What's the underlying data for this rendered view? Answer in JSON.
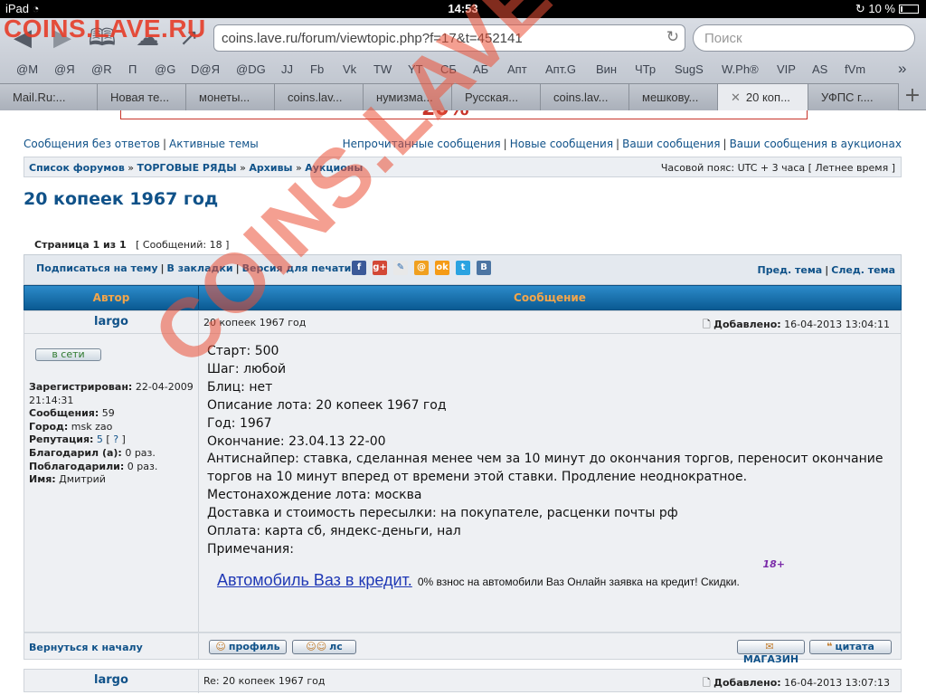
{
  "status": {
    "device": "iPad",
    "time": "14:53",
    "battery": "10 %"
  },
  "browser": {
    "site_logo": "COINS.LAVE.RU",
    "url": "coins.lave.ru/forum/viewtopic.php?f=17&t=452141",
    "search_placeholder": "Поиск",
    "bookmarks": [
      "@M",
      "@Я",
      "@R",
      "П",
      "@G",
      "D@Я",
      "@DG",
      "JJ",
      "Fb",
      "Vk",
      "TW",
      "YT",
      "СБ",
      "АБ",
      "Апт",
      "Апт.G",
      "Вин",
      "ЧТр",
      "SugS",
      "W.Ph®",
      "VIP",
      "AS",
      "fVm",
      "»"
    ],
    "tabs": [
      "Mail.Ru:...",
      "Новая те...",
      "монеты...",
      "coins.lav...",
      "нумизма...",
      "Русская...",
      "coins.lav...",
      "мешкову...",
      "20 коп...",
      "УФПС г...."
    ]
  },
  "links": {
    "unanswered": "Сообщения без ответов",
    "active": "Активные темы",
    "unread": "Непрочитанные сообщения",
    "new": "Новые сообщения",
    "yours": "Ваши сообщения",
    "yours_auctions": "Ваши сообщения в аукционах"
  },
  "breadcrumb": {
    "items": [
      "Список форумов",
      "ТОРГОВЫЕ РЯДЫ",
      "Архивы",
      "Аукционы"
    ],
    "timezone": "Часовой пояс: UTC + 3 часа [ Летнее время ]"
  },
  "topic": {
    "title": "20 копеек 1967 год",
    "page_label": "Страница",
    "page_current": "1",
    "page_of": "из",
    "page_total": "1",
    "messages": "[ Сообщений: 18 ]"
  },
  "actions": {
    "subscribe": "Подписаться на тему",
    "bookmark": "В закладки",
    "print": "Версия для печати",
    "prev": "Пред. тема",
    "next": "След. тема"
  },
  "table": {
    "author_col": "Автор",
    "message_col": "Сообщение"
  },
  "post1": {
    "author": "largo",
    "subject": "20 копеек 1967 год",
    "added_label": "Добавлено:",
    "added": "16-04-2013 13:04:11",
    "online": "в сети",
    "registered_label": "Зарегистрирован:",
    "registered": "22-04-2009 21:14:31",
    "messages_label": "Сообщения:",
    "messages": "59",
    "city_label": "Город:",
    "city": "msk zao",
    "rep_label": "Репутация:",
    "rep": "5",
    "rep_q": "?",
    "thanked_label": "Благодарил (а):",
    "thanked": "0 раз.",
    "thanks_label": "Поблагодарили:",
    "thanks": "0 раз.",
    "name_label": "Имя:",
    "name": "Дмитрий",
    "lines": [
      "Старт: 500",
      "Шаг: любой",
      "Блиц: нет",
      "Описание лота: 20 копеек 1967 год",
      "Год: 1967",
      "Окончание: 23.04.13 22-00",
      "Антиснайпер: ставка, сделанная менее чем за 10 минут до окончания торгов, переносит окончание торгов на 10 минут вперед от времени этой ставки. Продление неоднократное.",
      "Местонахождение лота: москва",
      "Доставка и стоимость пересылки: на покупателе, расценки почты рф",
      "Оплата: карта сб, яндекс-деньги, нал",
      "Примечания:"
    ],
    "ad_link": "Автомобиль Ваз в кредит.",
    "ad_text": "0% взнос на автомобили Ваз Онлайн заявка на кредит! Скидки.",
    "ad_age": "18+",
    "back_top": "Вернуться к началу",
    "btn_profile": "профиль",
    "btn_pm": "лс",
    "btn_shop": "МАГАЗИН",
    "btn_quote": "цитата"
  },
  "post2": {
    "author": "largo",
    "subject": "Re: 20 копеек 1967 год",
    "added_label": "Добавлено:",
    "added": "16-04-2013 13:07:13"
  },
  "watermark": "COINS.LAVE.RU",
  "colors": {
    "link": "#105289",
    "header_bar": "#1c76b3",
    "header_text": "#f3a54a",
    "watermark": "#eb5037"
  }
}
